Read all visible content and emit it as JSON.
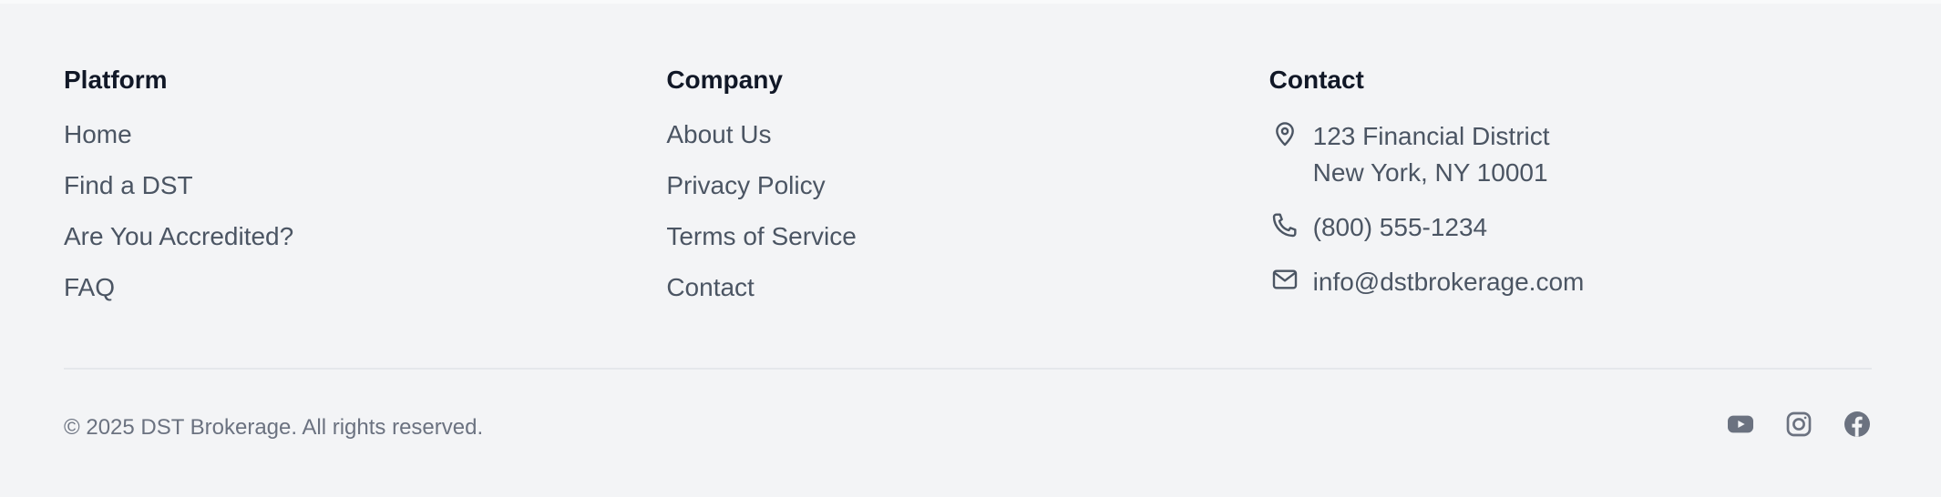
{
  "footer": {
    "platform": {
      "title": "Platform",
      "links": [
        "Home",
        "Find a DST",
        "Are You Accredited?",
        "FAQ"
      ]
    },
    "company": {
      "title": "Company",
      "links": [
        "About Us",
        "Privacy Policy",
        "Terms of Service",
        "Contact"
      ]
    },
    "contact": {
      "title": "Contact",
      "address_line1": "123 Financial District",
      "address_line2": "New York, NY 10001",
      "phone": "(800) 555-1234",
      "email": "info@dstbrokerage.com",
      "icons": [
        "map-pin-icon",
        "phone-icon",
        "mail-icon"
      ]
    },
    "copyright": "© 2025 DST Brokerage. All rights reserved.",
    "social_icons": [
      "youtube-icon",
      "instagram-icon",
      "facebook-icon"
    ],
    "colors": {
      "background": "#f3f4f6",
      "heading": "#111827",
      "link": "#4b5563",
      "muted": "#6b7280",
      "divider": "#e5e7eb"
    }
  }
}
